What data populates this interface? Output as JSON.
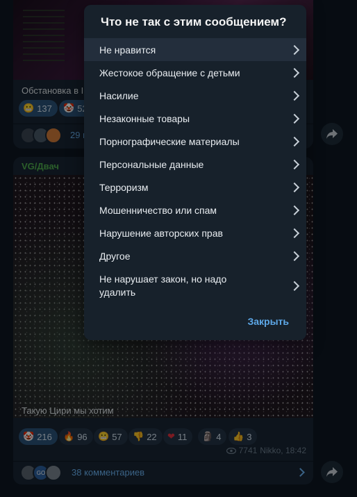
{
  "post1": {
    "caption": "Обстановка в І",
    "reactions": [
      {
        "icon": "grinning-face-icon",
        "emoji": "😬",
        "count": "137"
      },
      {
        "icon": "clown-face-icon",
        "emoji": "🤡",
        "count": "52"
      }
    ],
    "comments_label": "29 к"
  },
  "post2": {
    "channel": "VG/Двач",
    "caption": "Такую Цири мы хотим",
    "reactions": [
      {
        "icon": "clown-face-icon",
        "emoji": "🤡",
        "count": "216"
      },
      {
        "icon": "fire-icon",
        "emoji": "🔥",
        "count": "96"
      },
      {
        "icon": "grinning-face-icon",
        "emoji": "😬",
        "count": "57"
      },
      {
        "icon": "thumbs-down-icon",
        "emoji": "👎",
        "count": "22"
      },
      {
        "icon": "heart-icon",
        "emoji": "❤",
        "count": "11"
      },
      {
        "icon": "moai-icon",
        "emoji": "🗿",
        "count": "4"
      },
      {
        "icon": "thumbs-up-icon",
        "emoji": "👍",
        "count": "3"
      }
    ],
    "views": "7741",
    "author_time": "Nikko, 18:42",
    "comments_label": "38 комментариев",
    "avatar_badge": "GO"
  },
  "modal": {
    "title": "Что не так с этим сообщением?",
    "items": [
      "Не нравится",
      "Жестокое обращение с детьми",
      "Насилие",
      "Незаконные товары",
      "Порнографические материалы",
      "Персональные данные",
      "Терроризм",
      "Мошенничество или спам",
      "Нарушение авторских прав",
      "Другое",
      "Не нарушает закон, но надо удалить"
    ],
    "close_label": "Закрыть"
  },
  "colors": {
    "background": "#0e1621",
    "bubble": "#182533",
    "modal": "#17212b",
    "accent": "#5da8e8",
    "channel_name": "#4fae4e"
  }
}
